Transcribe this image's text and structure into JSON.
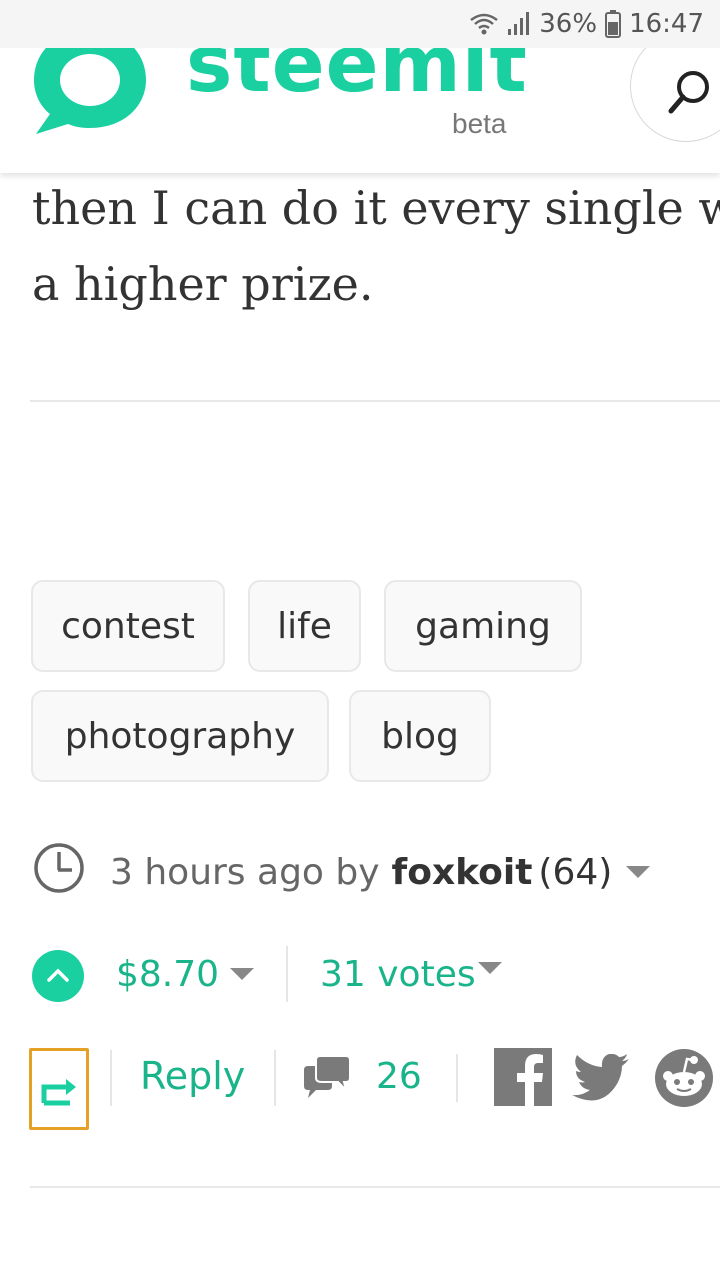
{
  "status_bar": {
    "battery": "36%",
    "time": "16:47"
  },
  "header": {
    "logo_text": "steemit",
    "logo_badge": "beta"
  },
  "post": {
    "body_lines": [
      "then I can do it every single w",
      "a higher prize."
    ],
    "tags": [
      "contest",
      "life",
      "gaming",
      "photography",
      "blog"
    ],
    "time_ago": "3 hours ago by",
    "author": "foxkoit",
    "reputation": "(64)",
    "payout": "$8.70",
    "votes": "31 votes",
    "reply_label": "Reply",
    "comment_count": "26"
  },
  "icons": [
    "wifi-icon",
    "signal-icon",
    "battery-icon",
    "steemit-logo-icon",
    "search-icon",
    "clock-icon",
    "upvote-icon",
    "resteem-icon",
    "comments-icon",
    "facebook-icon",
    "twitter-icon",
    "reddit-icon"
  ],
  "colors": {
    "brand": "#1ad0a0",
    "link": "#1ab48a",
    "resteem_border": "#e5a126"
  }
}
